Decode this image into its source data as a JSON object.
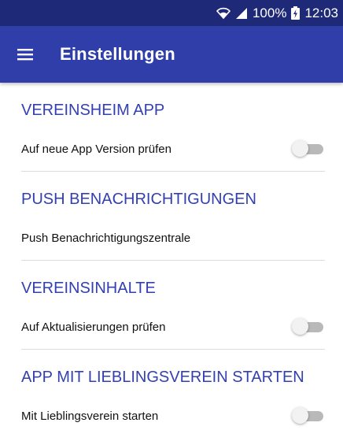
{
  "status_bar": {
    "battery": "100%",
    "time": "12:03"
  },
  "toolbar": {
    "title": "Einstellungen"
  },
  "sections": [
    {
      "header": "VEREINSHEIM APP",
      "item": {
        "label": "Auf neue App Version prüfen",
        "toggle": "off"
      }
    },
    {
      "header": "PUSH BENACHRICHTIGUNGEN",
      "item": {
        "label": "Push Benachrichtigungszentrale"
      }
    },
    {
      "header": "VEREINSINHALTE",
      "item": {
        "label": "Auf Aktualisierungen prüfen",
        "toggle": "off"
      }
    },
    {
      "header": "APP MIT LIEBLINGSVEREIN STARTEN",
      "item": {
        "label": "Mit Lieblingsverein starten",
        "toggle": "off"
      }
    }
  ],
  "colors": {
    "status_bar": "#1e2a78",
    "toolbar": "#2f3ea8",
    "section_header": "#3340b0"
  }
}
